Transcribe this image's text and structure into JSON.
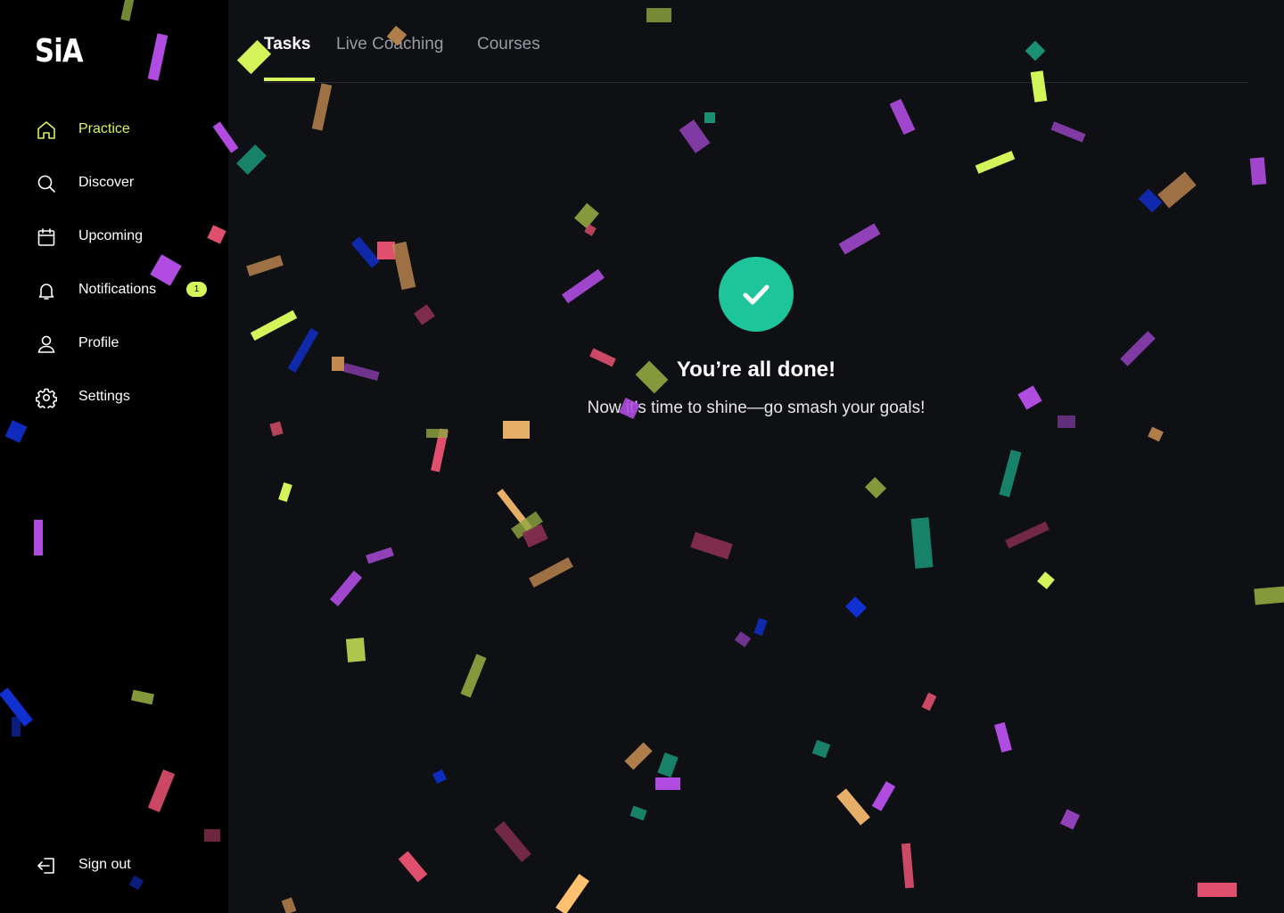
{
  "app": {
    "logo": "SiA"
  },
  "sidebar": {
    "items": [
      {
        "label": "Practice",
        "icon": "home-icon",
        "active": true
      },
      {
        "label": "Discover",
        "icon": "search-icon"
      },
      {
        "label": "Upcoming",
        "icon": "calendar-icon"
      },
      {
        "label": "Notifications",
        "icon": "bell-icon",
        "badge": "1"
      },
      {
        "label": "Profile",
        "icon": "user-icon"
      },
      {
        "label": "Settings",
        "icon": "gear-icon"
      }
    ],
    "signout": {
      "label": "Sign out",
      "icon": "sign-out-icon"
    }
  },
  "tabs": [
    {
      "label": "Tasks",
      "active": true
    },
    {
      "label": "Live Coaching"
    },
    {
      "label": "Courses"
    }
  ],
  "completion": {
    "icon": "check-circle-icon",
    "title": "You’re all done!",
    "subtitle": "Now it’s time to shine—go smash your goals!"
  },
  "colors": {
    "accent": "#d4f55a",
    "success": "#1ec49a",
    "background": "#0f1014",
    "sidebar": "#000000",
    "confetti": [
      "#b04de0",
      "#d4f55a",
      "#e0506e",
      "#1a8f72",
      "#1030d0",
      "#c08a50",
      "#ffc070",
      "#90a840",
      "#8a3050"
    ]
  }
}
